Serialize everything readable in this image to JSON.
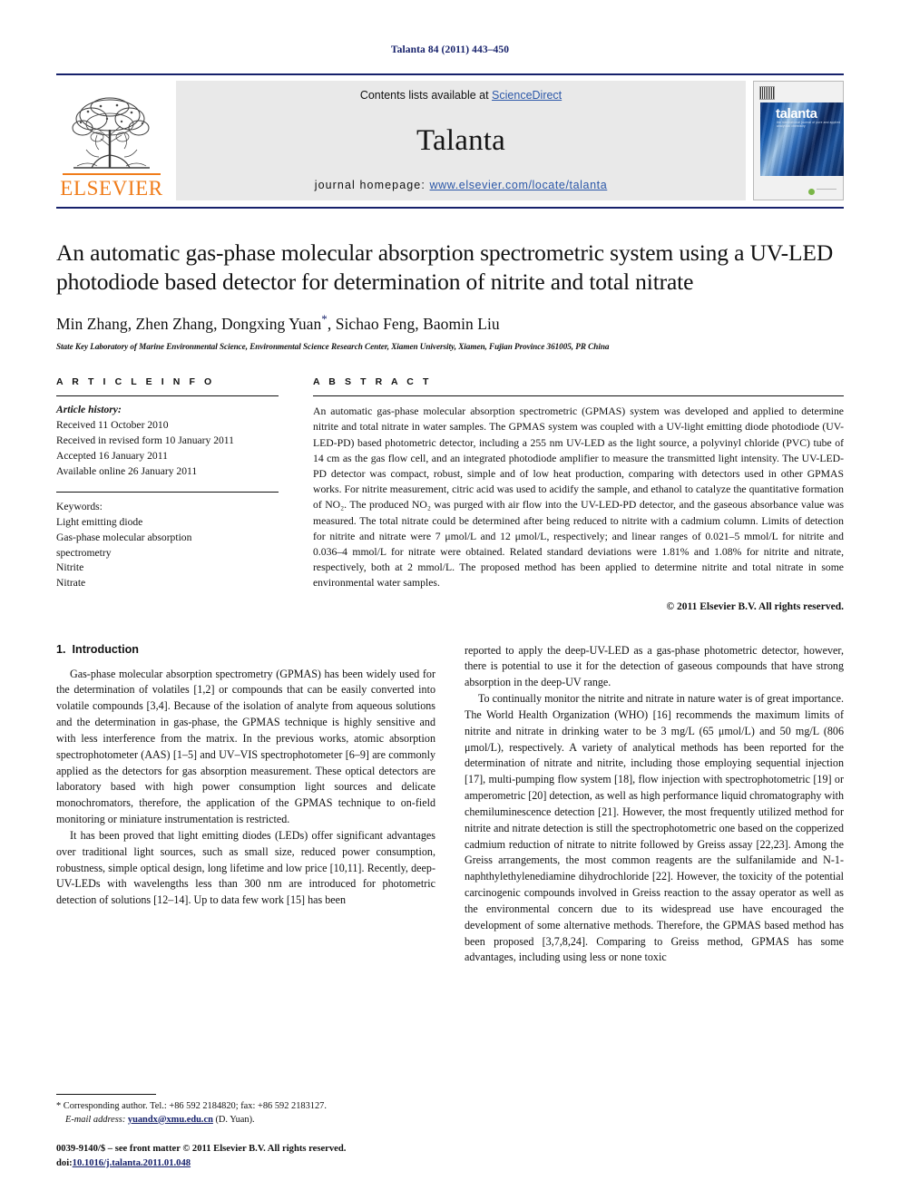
{
  "running_head": "Talanta 84 (2011) 443–450",
  "masthead": {
    "publisher_name": "ELSEVIER",
    "contents_prefix": "Contents lists available at ",
    "contents_link": "ScienceDirect",
    "journal_name": "Talanta",
    "homepage_label": "journal homepage:",
    "homepage_url": "www.elsevier.com/locate/talanta",
    "cover_title": "talanta",
    "cover_subtitle": "the international journal of pure and applied analytical chemistry"
  },
  "article": {
    "title": "An automatic gas-phase molecular absorption spectrometric system using a UV-LED photodiode based detector for determination of nitrite and total nitrate",
    "authors": "Min Zhang, Zhen Zhang, Dongxing Yuan",
    "authors_tail": ", Sichao Feng, Baomin Liu",
    "corresponding_mark": "*",
    "affiliation": "State Key Laboratory of Marine Environmental Science, Environmental Science Research Center, Xiamen University, Xiamen, Fujian Province 361005, PR China"
  },
  "article_info": {
    "heading": "A R T I C L E    I N F O",
    "history_label": "Article history:",
    "history": [
      "Received 11 October 2010",
      "Received in revised form 10 January 2011",
      "Accepted 16 January 2011",
      "Available online 26 January 2011"
    ],
    "keywords_label": "Keywords:",
    "keywords": [
      "Light emitting diode",
      "Gas-phase molecular absorption",
      "spectrometry",
      "Nitrite",
      "Nitrate"
    ]
  },
  "abstract": {
    "heading": "A B S T R A C T",
    "text": "An automatic gas-phase molecular absorption spectrometric (GPMAS) system was developed and applied to determine nitrite and total nitrate in water samples. The GPMAS system was coupled with a UV-light emitting diode photodiode (UV-LED-PD) based photometric detector, including a 255 nm UV-LED as the light source, a polyvinyl chloride (PVC) tube of 14 cm as the gas flow cell, and an integrated photodiode amplifier to measure the transmitted light intensity. The UV-LED-PD detector was compact, robust, simple and of low heat production, comparing with detectors used in other GPMAS works. For nitrite measurement, citric acid was used to acidify the sample, and ethanol to catalyze the quantitative formation of NO₂. The produced NO₂ was purged with air flow into the UV-LED-PD detector, and the gaseous absorbance value was measured. The total nitrate could be determined after being reduced to nitrite with a cadmium column. Limits of detection for nitrite and nitrate were 7 μmol/L and 12 μmol/L, respectively; and linear ranges of 0.021–5 mmol/L for nitrite and 0.036–4 mmol/L for nitrate were obtained. Related standard deviations were 1.81% and 1.08% for nitrite and nitrate, respectively, both at 2 mmol/L. The proposed method has been applied to determine nitrite and total nitrate in some environmental water samples.",
    "copyright": "© 2011 Elsevier B.V. All rights reserved."
  },
  "introduction": {
    "heading_number": "1.",
    "heading_text": "Introduction",
    "left_paragraphs": [
      "Gas-phase molecular absorption spectrometry (GPMAS) has been widely used for the determination of volatiles [1,2] or compounds that can be easily converted into volatile compounds [3,4]. Because of the isolation of analyte from aqueous solutions and the determination in gas-phase, the GPMAS technique is highly sensitive and with less interference from the matrix. In the previous works, atomic absorption spectrophotometer (AAS) [1–5] and UV–VIS spectrophotometer [6–9] are commonly applied as the detectors for gas absorption measurement. These optical detectors are laboratory based with high power consumption light sources and delicate monochromators, therefore, the application of the GPMAS technique to on-field monitoring or miniature instrumentation is restricted.",
      "It has been proved that light emitting diodes (LEDs) offer significant advantages over traditional light sources, such as small size, reduced power consumption, robustness, simple optical design, long lifetime and low price [10,11]. Recently, deep-UV-LEDs with wavelengths less than 300 nm are introduced for photometric detection of solutions [12–14]. Up to data few work [15] has been"
    ],
    "right_paragraphs": [
      "reported to apply the deep-UV-LED as a gas-phase photometric detector, however, there is potential to use it for the detection of gaseous compounds that have strong absorption in the deep-UV range.",
      "To continually monitor the nitrite and nitrate in nature water is of great importance. The World Health Organization (WHO) [16] recommends the maximum limits of nitrite and nitrate in drinking water to be 3 mg/L (65 μmol/L) and 50 mg/L (806 μmol/L), respectively. A variety of analytical methods has been reported for the determination of nitrate and nitrite, including those employing sequential injection [17], multi-pumping flow system [18], flow injection with spectrophotometric [19] or amperometric [20] detection, as well as high performance liquid chromatography with chemiluminescence detection [21]. However, the most frequently utilized method for nitrite and nitrate detection is still the spectrophotometric one based on the copperized cadmium reduction of nitrate to nitrite followed by Greiss assay [22,23]. Among the Greiss arrangements, the most common reagents are the sulfanilamide and N-1-naphthylethylenediamine dihydrochloride [22]. However, the toxicity of the potential carcinogenic compounds involved in Greiss reaction to the assay operator as well as the environmental concern due to its widespread use have encouraged the development of some alternative methods. Therefore, the GPMAS based method has been proposed [3,7,8,24]. Comparing to Greiss method, GPMAS has some advantages, including using less or none toxic"
    ]
  },
  "footnote": {
    "corresponding": "* Corresponding author. Tel.: +86 592 2184820; fax: +86 592 2183127.",
    "email_label": "E-mail address:",
    "email": "yuandx@xmu.edu.cn",
    "email_suffix": " (D. Yuan).",
    "issn_line": "0039-9140/$ – see front matter © 2011 Elsevier B.V. All rights reserved.",
    "doi_label": "doi:",
    "doi": "10.1016/j.talanta.2011.01.048"
  },
  "colors": {
    "rule_navy": "#16216b",
    "link_blue": "#2b57a8",
    "elsevier_orange": "#f07c1a",
    "reference_navy": "#16216b"
  }
}
